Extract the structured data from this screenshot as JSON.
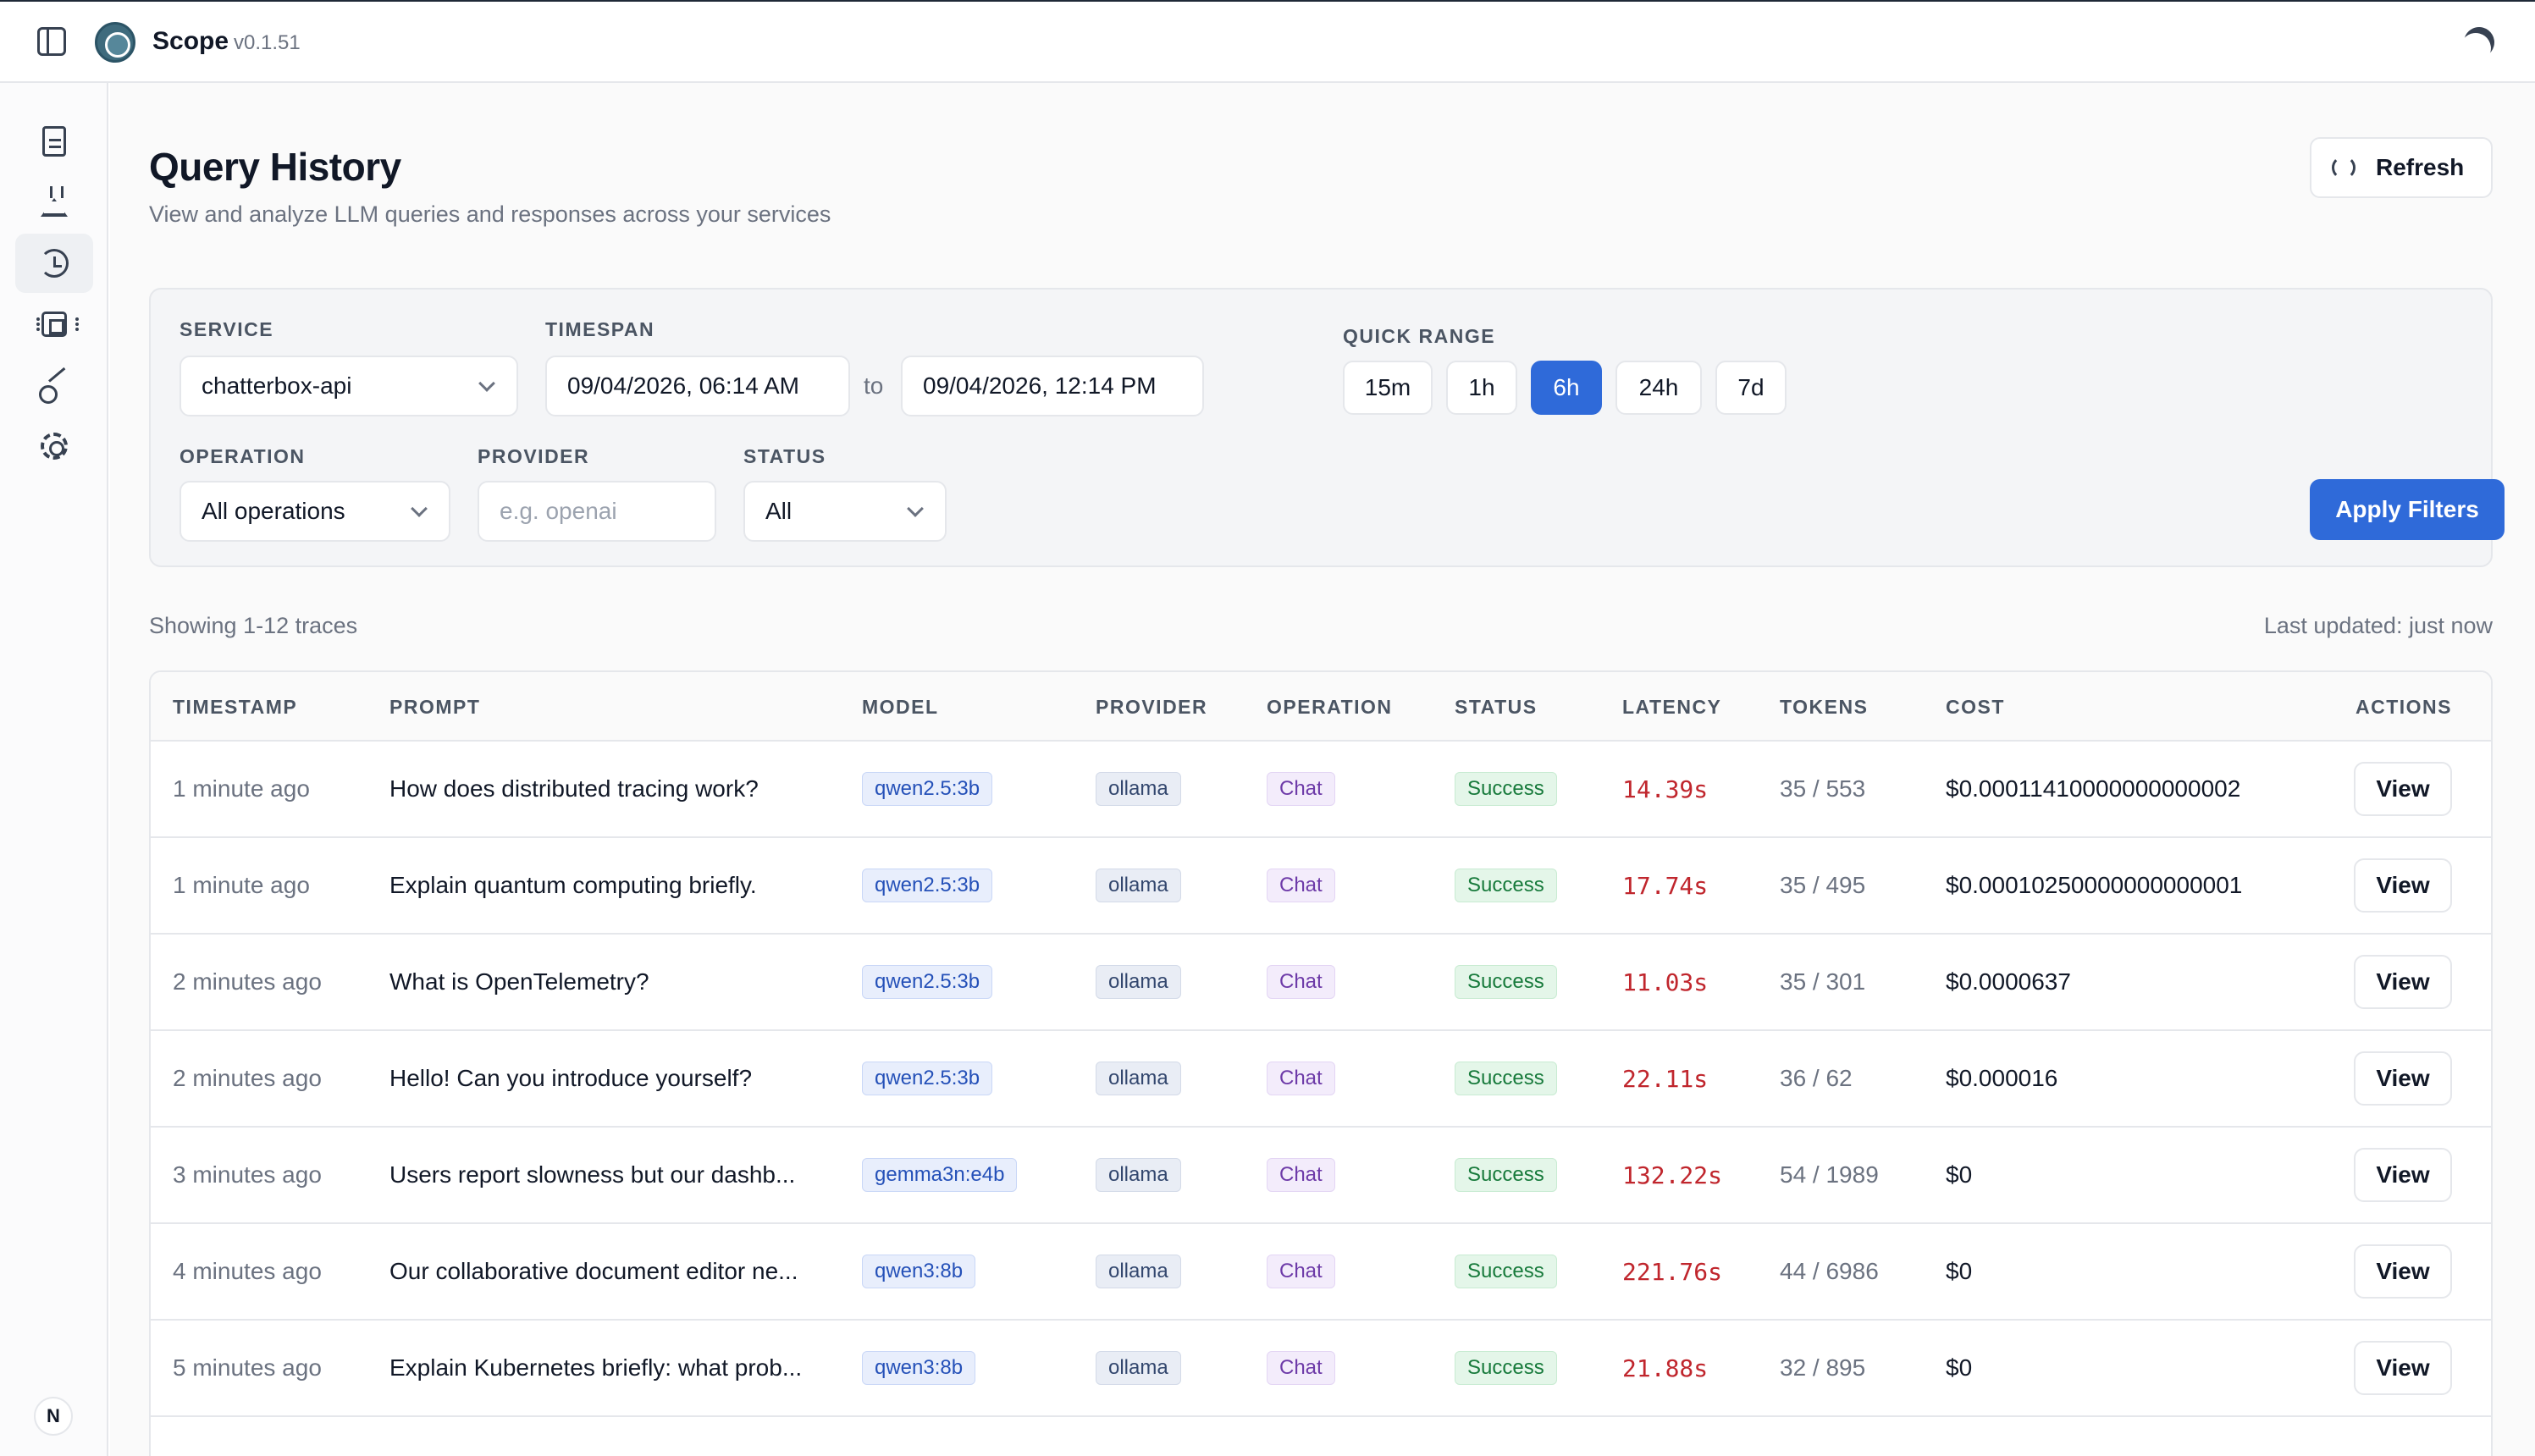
{
  "app": {
    "name": "Scope",
    "version": "v0.1.51",
    "user_initial": "N"
  },
  "icons": {
    "sidebar_toggle": "sidebar-toggle-icon",
    "theme": "moon-icon",
    "nav": [
      "document-icon",
      "flask-icon",
      "history-icon",
      "chip-icon",
      "key-icon",
      "gear-icon"
    ],
    "refresh": "refresh-icon"
  },
  "page": {
    "title": "Query History",
    "subtitle": "View and analyze LLM queries and responses across your services",
    "refresh_label": "Refresh"
  },
  "filters": {
    "service_label": "SERVICE",
    "service_value": "chatterbox-api",
    "timespan_label": "TIMESPAN",
    "from_value": "09/04/2026, 06:14 AM",
    "to_text": "to",
    "to_value": "09/04/2026, 12:14 PM",
    "quick_range_label": "QUICK RANGE",
    "quick_ranges": [
      "15m",
      "1h",
      "6h",
      "24h",
      "7d"
    ],
    "quick_range_selected": "6h",
    "operation_label": "OPERATION",
    "operation_value": "All operations",
    "provider_label": "PROVIDER",
    "provider_placeholder": "e.g. openai",
    "status_label": "STATUS",
    "status_value": "All",
    "apply_label": "Apply Filters"
  },
  "summary": {
    "showing": "Showing 1-12 traces",
    "last_updated": "Last updated: just now"
  },
  "table": {
    "headers": [
      "TIMESTAMP",
      "PROMPT",
      "MODEL",
      "PROVIDER",
      "OPERATION",
      "STATUS",
      "LATENCY",
      "TOKENS",
      "COST",
      "ACTIONS"
    ],
    "view_label": "View",
    "rows": [
      {
        "timestamp": "1 minute ago",
        "prompt": "How does distributed tracing work?",
        "model": "qwen2.5:3b",
        "provider": "ollama",
        "operation": "Chat",
        "status": "Success",
        "latency": "14.39s",
        "tokens": "35 / 553",
        "cost": "$0.00011410000000000002"
      },
      {
        "timestamp": "1 minute ago",
        "prompt": "Explain quantum computing briefly.",
        "model": "qwen2.5:3b",
        "provider": "ollama",
        "operation": "Chat",
        "status": "Success",
        "latency": "17.74s",
        "tokens": "35 / 495",
        "cost": "$0.00010250000000000001"
      },
      {
        "timestamp": "2 minutes ago",
        "prompt": "What is OpenTelemetry?",
        "model": "qwen2.5:3b",
        "provider": "ollama",
        "operation": "Chat",
        "status": "Success",
        "latency": "11.03s",
        "tokens": "35 / 301",
        "cost": "$0.0000637"
      },
      {
        "timestamp": "2 minutes ago",
        "prompt": "Hello! Can you introduce yourself?",
        "model": "qwen2.5:3b",
        "provider": "ollama",
        "operation": "Chat",
        "status": "Success",
        "latency": "22.11s",
        "tokens": "36 / 62",
        "cost": "$0.000016"
      },
      {
        "timestamp": "3 minutes ago",
        "prompt": "Users report slowness but our dashb...",
        "model": "gemma3n:e4b",
        "provider": "ollama",
        "operation": "Chat",
        "status": "Success",
        "latency": "132.22s",
        "tokens": "54 / 1989",
        "cost": "$0"
      },
      {
        "timestamp": "4 minutes ago",
        "prompt": "Our collaborative document editor ne...",
        "model": "qwen3:8b",
        "provider": "ollama",
        "operation": "Chat",
        "status": "Success",
        "latency": "221.76s",
        "tokens": "44 / 6986",
        "cost": "$0"
      },
      {
        "timestamp": "5 minutes ago",
        "prompt": "Explain Kubernetes briefly: what prob...",
        "model": "qwen3:8b",
        "provider": "ollama",
        "operation": "Chat",
        "status": "Success",
        "latency": "21.88s",
        "tokens": "32 / 895",
        "cost": "$0"
      }
    ]
  }
}
